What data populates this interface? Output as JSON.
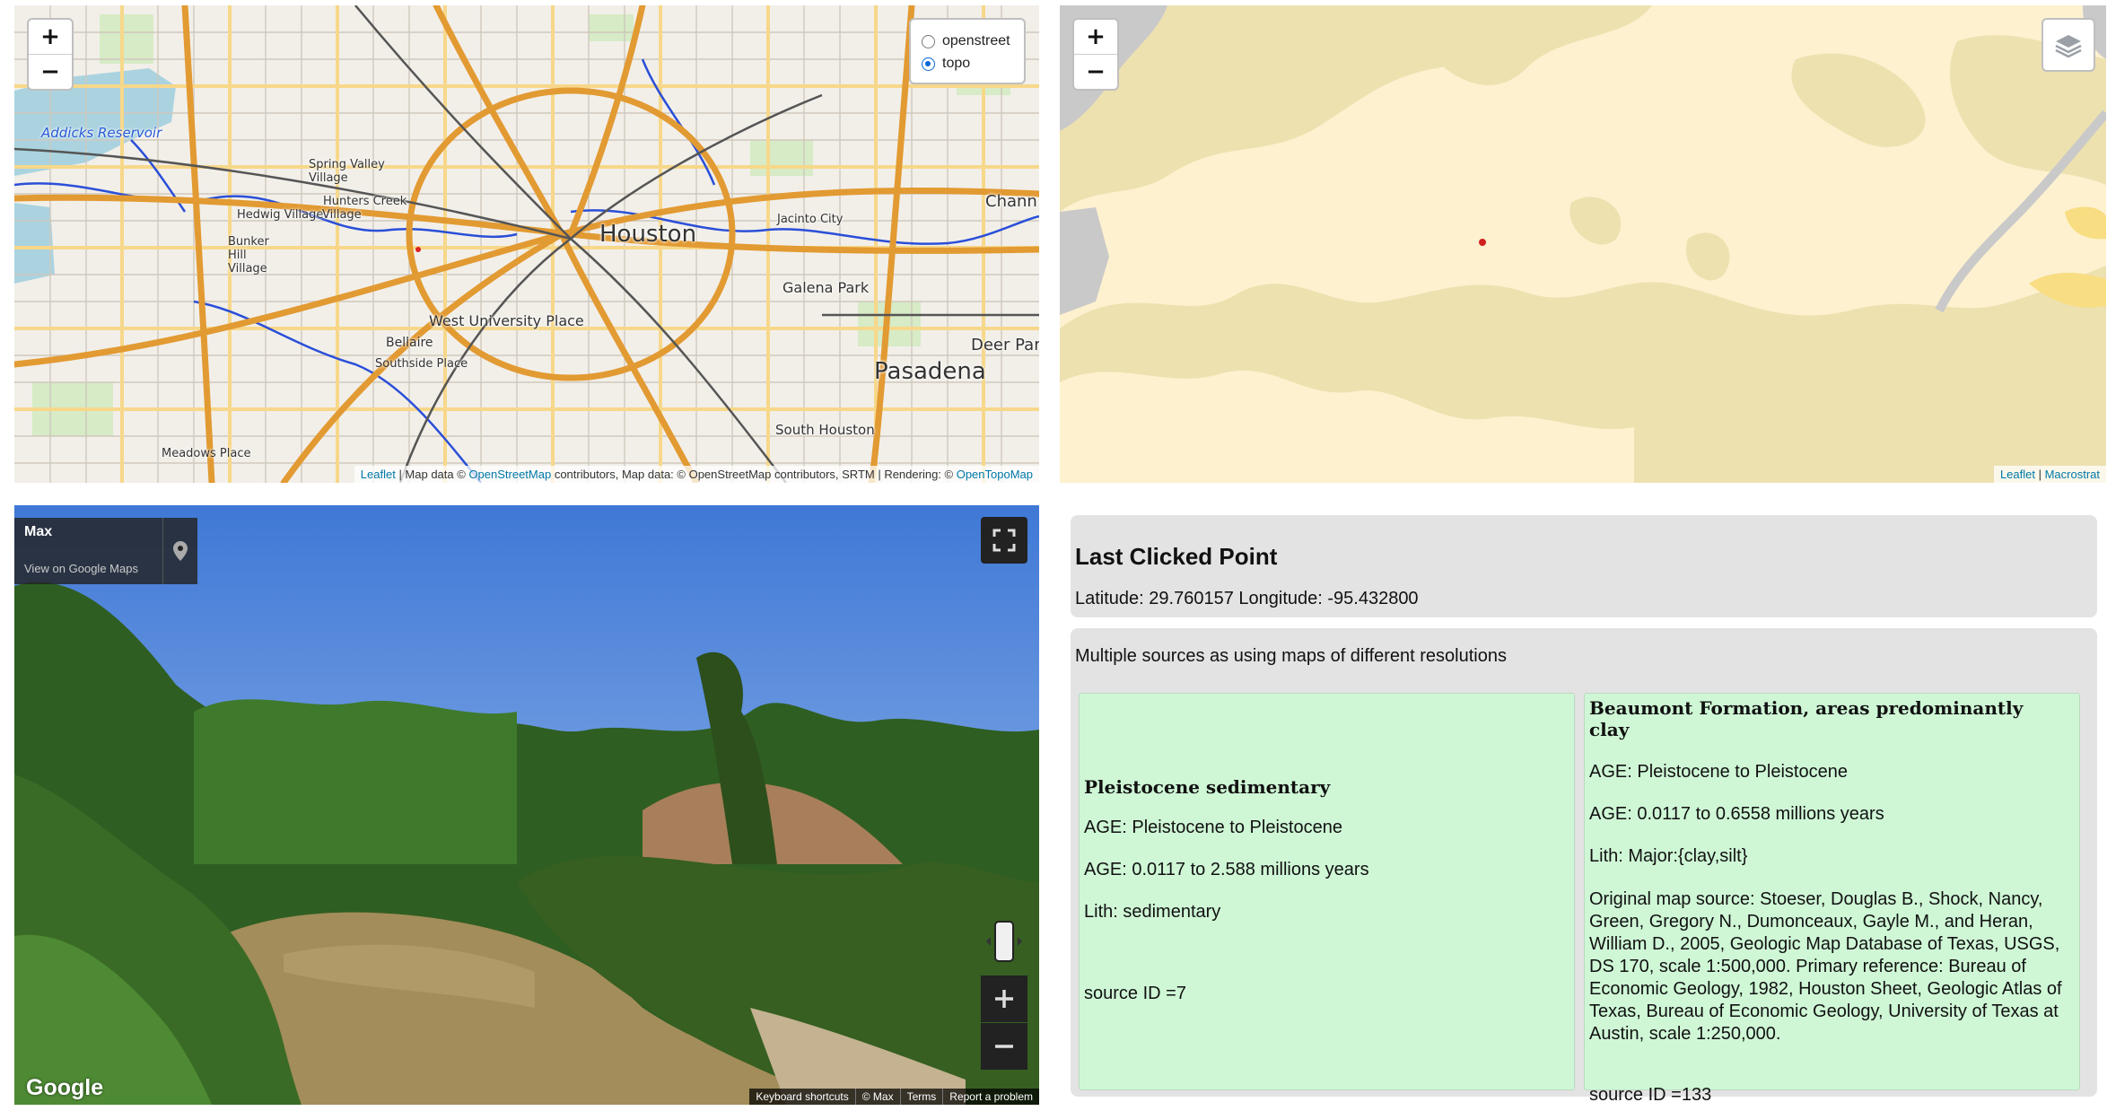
{
  "topo_map": {
    "zoom_in": "+",
    "zoom_out": "−",
    "layer_options": [
      {
        "label": "openstreet",
        "selected": false
      },
      {
        "label": "topo",
        "selected": true
      }
    ],
    "place_labels": [
      "Addicks Reservoir",
      "Spring Valley Village",
      "Hunters Creek",
      "Hedwig Village",
      "Village",
      "Bunker Hill Village",
      "Houston",
      "Jacinto City",
      "Chann",
      "Galena Park",
      "West University Place",
      "Bellaire",
      "Southside Place",
      "Deer Par",
      "Pasadena",
      "South Houston",
      "Meadows Place"
    ],
    "attribution": {
      "leaflet": "Leaflet",
      "sep": " | Map data © ",
      "osm": "OpenStreetMap",
      "rest": " contributors, Map data: © OpenStreetMap contributors, SRTM | Rendering: © ",
      "otm": "OpenTopoMap"
    }
  },
  "geo_map": {
    "zoom_in": "+",
    "zoom_out": "−",
    "layers_icon": "layers-icon",
    "attribution": {
      "leaflet": "Leaflet",
      "sep": " | ",
      "macrostrat": "Macrostrat"
    },
    "colors": {
      "pleistocene": "#fdf1cf",
      "older": "#ede1b0",
      "water": "#c9c9c9",
      "yellow_unit": "#f8dd82"
    }
  },
  "street_view": {
    "title": "Max",
    "maps_link": "View on Google Maps",
    "logo": "Google",
    "footer": [
      "Keyboard shortcuts",
      "© Max",
      "Terms",
      "Report a problem"
    ]
  },
  "last_clicked": {
    "heading": "Last Clicked Point",
    "coords": "Latitude: 29.760157 Longitude: -95.432800"
  },
  "sources": {
    "intro": "Multiple sources as using maps of different resolutions",
    "units": [
      {
        "name": "Pleistocene sedimentary",
        "age": "AGE: Pleistocene to Pleistocene",
        "age_range": "AGE: 0.0117 to 2.588 millions years",
        "lith": "Lith: sedimentary",
        "source_id": "source ID =7"
      },
      {
        "name": "Beaumont Formation, areas predominantly clay",
        "age": "AGE: Pleistocene to Pleistocene",
        "age_range": "AGE: 0.0117 to 0.6558 millions years",
        "lith": "Lith: Major:{clay,silt}",
        "ref": "Original map source: Stoeser, Douglas B., Shock, Nancy, Green, Gregory N., Dumonceaux, Gayle M., and Heran, William D., 2005, Geologic Map Database of Texas, USGS, DS 170, scale 1:500,000. Primary reference: Bureau of Economic Geology, 1982, Houston Sheet, Geologic Atlas of Texas, Bureau of Economic Geology, University of Texas at Austin, scale 1:250,000.",
        "source_id": "source ID =133"
      }
    ]
  }
}
